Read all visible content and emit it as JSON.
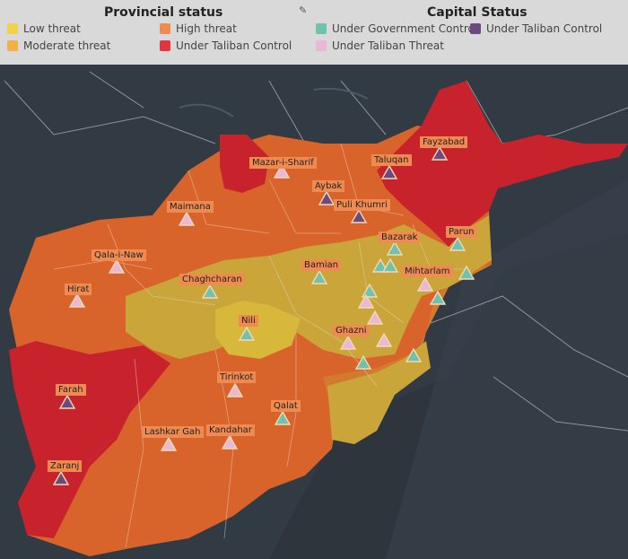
{
  "legend": {
    "provincial": {
      "title": "Provincial status",
      "items": [
        {
          "label": "Low threat",
          "color": "#f1d24a"
        },
        {
          "label": "High threat",
          "color": "#ef8a50"
        },
        {
          "label": "Moderate threat",
          "color": "#f3b045"
        },
        {
          "label": "Under Taliban Control",
          "color": "#e3353f"
        }
      ]
    },
    "capital": {
      "title": "Capital Status",
      "items": [
        {
          "label": "Under Government Control",
          "color": "#71c2ac"
        },
        {
          "label": "Under Taliban Control",
          "color": "#6b4a7d"
        },
        {
          "label": "Under Taliban Threat",
          "color": "#eab8d4"
        }
      ]
    }
  },
  "colors": {
    "taliban": "#c8232c",
    "high": "#d8642c",
    "moderate": "#d27a30",
    "low": "#c9a53a",
    "lowest": "#d8b83a",
    "gov": "#71c2ac",
    "tal": "#6b4a7d",
    "threat": "#eab8d4",
    "labelbg": "#ef8a50"
  },
  "cities": [
    {
      "name": "Mazar-i-Sharif",
      "status": "threat"
    },
    {
      "name": "Fayzabad",
      "status": "taliban"
    },
    {
      "name": "Taluqan",
      "status": "taliban"
    },
    {
      "name": "Aybak",
      "status": "taliban"
    },
    {
      "name": "Maimana",
      "status": "threat"
    },
    {
      "name": "Puli Khumri",
      "status": "taliban"
    },
    {
      "name": "Bazarak",
      "status": "gov"
    },
    {
      "name": "Parun",
      "status": "gov"
    },
    {
      "name": "Qala-i-Naw",
      "status": "threat"
    },
    {
      "name": "Bamian",
      "status": "gov"
    },
    {
      "name": "Mihtarlam",
      "status": "threat"
    },
    {
      "name": "Hirat",
      "status": "threat"
    },
    {
      "name": "Chaghcharan",
      "status": "gov"
    },
    {
      "name": "Nili",
      "status": "gov"
    },
    {
      "name": "Ghazni",
      "status": "threat"
    },
    {
      "name": "Tirinkot",
      "status": "threat"
    },
    {
      "name": "Farah",
      "status": "taliban"
    },
    {
      "name": "Qalat",
      "status": "gov"
    },
    {
      "name": "Lashkar Gah",
      "status": "threat"
    },
    {
      "name": "Kandahar",
      "status": "threat"
    },
    {
      "name": "Zaranj",
      "status": "taliban"
    }
  ]
}
